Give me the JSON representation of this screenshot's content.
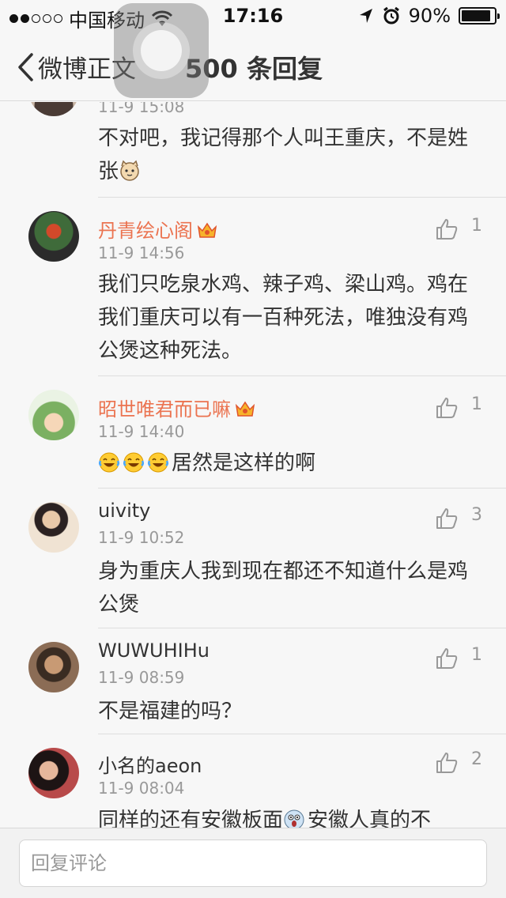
{
  "status_bar": {
    "carrier": "中国移动",
    "time": "17:16",
    "battery": "90%",
    "battery_level": 0.9
  },
  "nav": {
    "back_label": "微博正文",
    "title": "500 条回复"
  },
  "comments": [
    {
      "name": "",
      "time": "11-9 15:08",
      "text": "不对吧，我记得那个人叫王重庆，不是姓张",
      "likes": ""
    },
    {
      "name": "丹青绘心阁",
      "time": "11-9 14:56",
      "text": "我们只吃泉水鸡、辣子鸡、梁山鸡。鸡在我们重庆可以有一百种死法，唯独没有鸡公煲这种死法。",
      "likes": "1",
      "name_color": "#eb7350",
      "vip": true
    },
    {
      "name": "昭世唯君而已嘛",
      "time": "11-9 14:40",
      "text": "居然是这样的啊",
      "likes": "1",
      "name_color": "#eb7350",
      "vip": true,
      "emoji_prefix": [
        "laughing-tears",
        "laughing-tears",
        "laughing-tears"
      ]
    },
    {
      "name": "uivity",
      "time": "11-9 10:52",
      "text": "身为重庆人我到现在都还不知道什么是鸡公煲",
      "likes": "3"
    },
    {
      "name": "WUWUHIHu",
      "time": "11-9 08:59",
      "text": "不是福建的吗？",
      "likes": "1"
    },
    {
      "name": "小名的aeon",
      "time": "11-9 08:04",
      "text_before": "同样的还有安徽板面",
      "text_after": "安徽人真的不",
      "likes": "2"
    }
  ],
  "reply": {
    "placeholder": "回复评论"
  },
  "colors": {
    "accent_name": "#eb7350",
    "text": "#333333",
    "muted": "#999999",
    "background": "#f7f7f7"
  }
}
